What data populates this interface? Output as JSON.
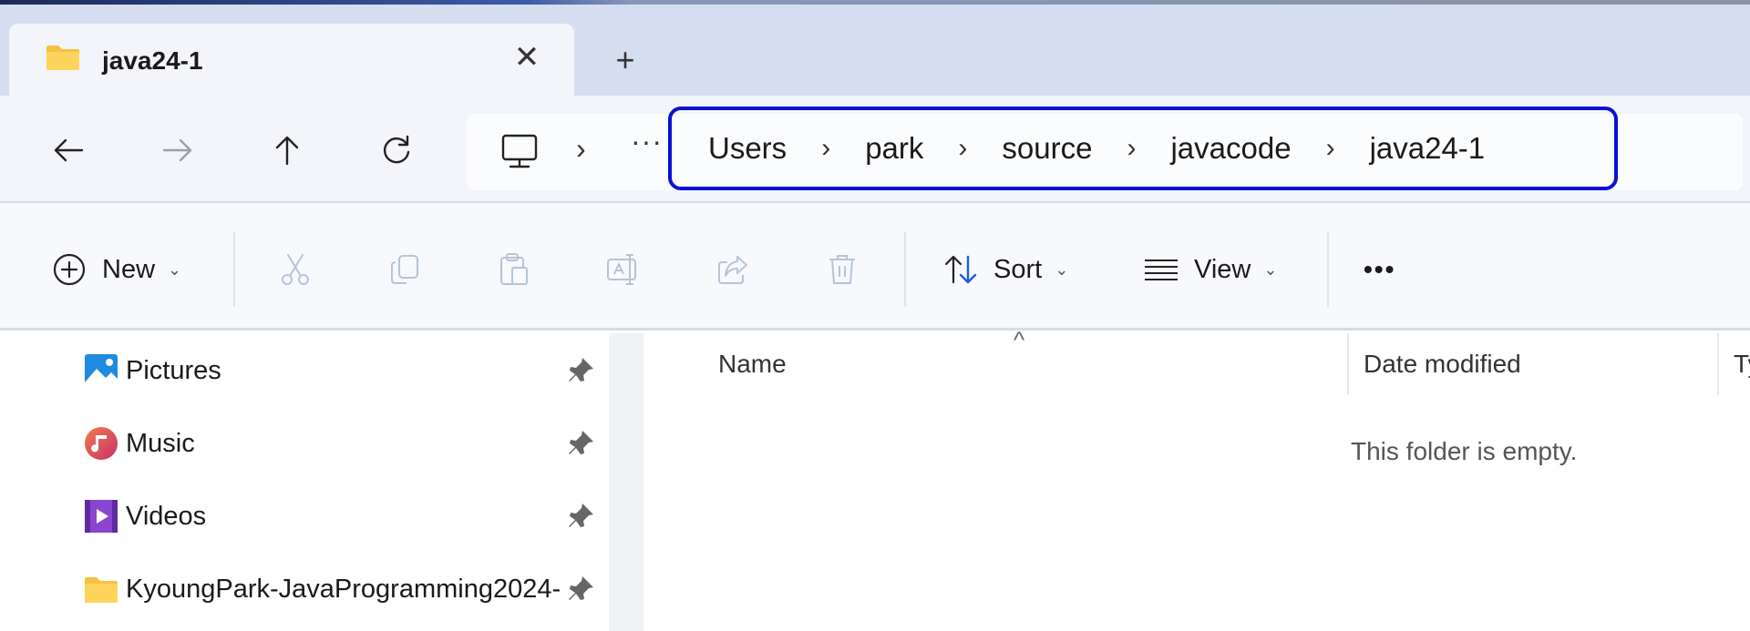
{
  "window": {
    "tab_title": "java24-1",
    "tab_close": "✕",
    "new_tab": "+"
  },
  "address": {
    "overflow": "···",
    "separator": "›",
    "breadcrumbs": [
      "Users",
      "park",
      "source",
      "javacode",
      "java24-1"
    ]
  },
  "toolbar": {
    "new_label": "New",
    "sort_label": "Sort",
    "view_label": "View",
    "more_label": "•••",
    "caret": "⌄"
  },
  "sidebar": {
    "items": [
      {
        "label": "Pictures",
        "icon": "pictures-icon"
      },
      {
        "label": "Music",
        "icon": "music-icon"
      },
      {
        "label": "Videos",
        "icon": "videos-icon"
      },
      {
        "label": "KyoungPark-JavaProgramming2024-",
        "icon": "folder-icon"
      }
    ]
  },
  "content": {
    "sort_indicator": "^",
    "columns": {
      "name": "Name",
      "date": "Date modified",
      "type": "Ty"
    },
    "empty_message": "This folder is empty."
  },
  "colors": {
    "accent_box": "#0a10d8",
    "tabbar_bg": "#d4def0",
    "folder_yellow": "#f5c142"
  }
}
